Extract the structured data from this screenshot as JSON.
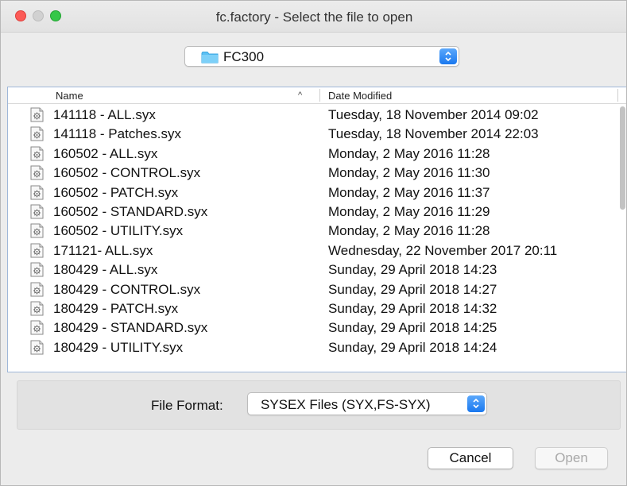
{
  "window": {
    "title": "fc.factory - Select the file to open"
  },
  "folder_selector": {
    "current": "FC300",
    "icon": "folder-icon"
  },
  "file_list": {
    "columns": {
      "name": "Name",
      "date": "Date Modified",
      "sort_indicator": "^"
    },
    "rows": [
      {
        "name": "141118 - ALL.syx",
        "date": "Tuesday, 18 November 2014 09:02"
      },
      {
        "name": "141118 - Patches.syx",
        "date": "Tuesday, 18 November 2014 22:03"
      },
      {
        "name": "160502 - ALL.syx",
        "date": "Monday, 2 May 2016 11:28"
      },
      {
        "name": "160502 - CONTROL.syx",
        "date": "Monday, 2 May 2016 11:30"
      },
      {
        "name": "160502 - PATCH.syx",
        "date": "Monday, 2 May 2016 11:37"
      },
      {
        "name": "160502 - STANDARD.syx",
        "date": "Monday, 2 May 2016 11:29"
      },
      {
        "name": "160502 - UTILITY.syx",
        "date": "Monday, 2 May 2016 11:28"
      },
      {
        "name": "171121- ALL.syx",
        "date": "Wednesday, 22 November 2017 20:11"
      },
      {
        "name": "180429 - ALL.syx",
        "date": "Sunday, 29 April 2018 14:23"
      },
      {
        "name": "180429 - CONTROL.syx",
        "date": "Sunday, 29 April 2018 14:27"
      },
      {
        "name": "180429 - PATCH.syx",
        "date": "Sunday, 29 April 2018 14:32"
      },
      {
        "name": "180429 - STANDARD.syx",
        "date": "Sunday, 29 April 2018 14:25"
      },
      {
        "name": "180429 - UTILITY.syx",
        "date": "Sunday, 29 April 2018 14:24"
      }
    ]
  },
  "file_format": {
    "label": "File Format:",
    "selected": "SYSEX Files (SYX,FS-SYX)"
  },
  "buttons": {
    "cancel": "Cancel",
    "open": "Open"
  },
  "colors": {
    "accent": "#1a78ef",
    "close": "#fc5b57",
    "zoom": "#35c748",
    "disabled_text": "#a9a9a9"
  }
}
